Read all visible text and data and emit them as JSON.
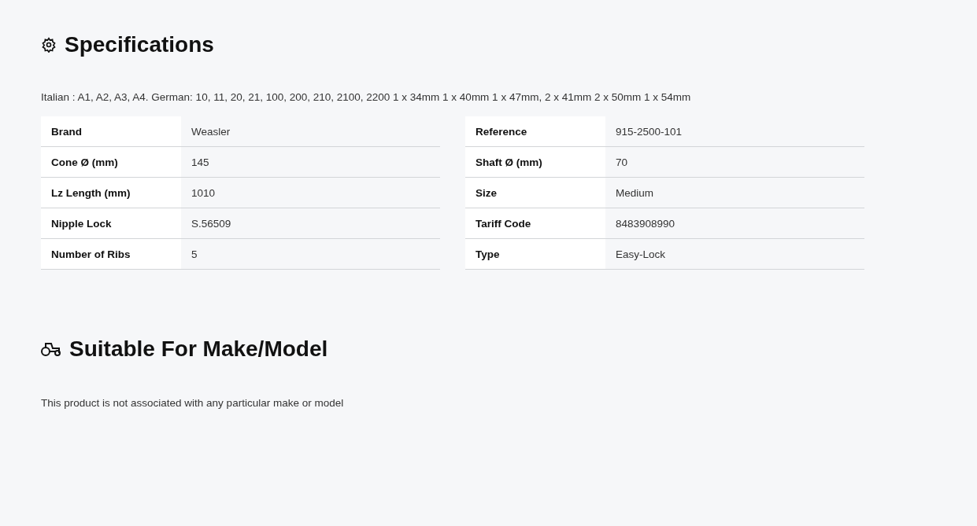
{
  "sections": [
    {
      "kind": "specs",
      "title": "Specifications",
      "description": "Italian : A1, A2, A3, A4. German: 10, 11, 20, 21, 100, 200, 210, 2100, 2200 1 x 34mm 1 x 40mm 1 x 47mm, 2 x 41mm 2 x 50mm 1 x 54mm",
      "tables": [
        {
          "rows": [
            {
              "label": "Brand",
              "value": "Weasler"
            },
            {
              "label": "Cone Ø (mm)",
              "value": "145"
            },
            {
              "label": "Lz Length (mm)",
              "value": "1010"
            },
            {
              "label": "Nipple Lock",
              "value": "S.56509"
            },
            {
              "label": "Number of Ribs",
              "value": "5"
            }
          ]
        },
        {
          "rows": [
            {
              "label": "Reference",
              "value": "915-2500-101"
            },
            {
              "label": "Shaft Ø (mm)",
              "value": "70"
            },
            {
              "label": "Size",
              "value": "Medium"
            },
            {
              "label": "Tariff Code",
              "value": "8483908990"
            },
            {
              "label": "Type",
              "value": "Easy-Lock"
            }
          ]
        }
      ]
    },
    {
      "kind": "models",
      "title": "Suitable For Make/Model",
      "description": "This product is not associated with any particular make or model"
    }
  ]
}
